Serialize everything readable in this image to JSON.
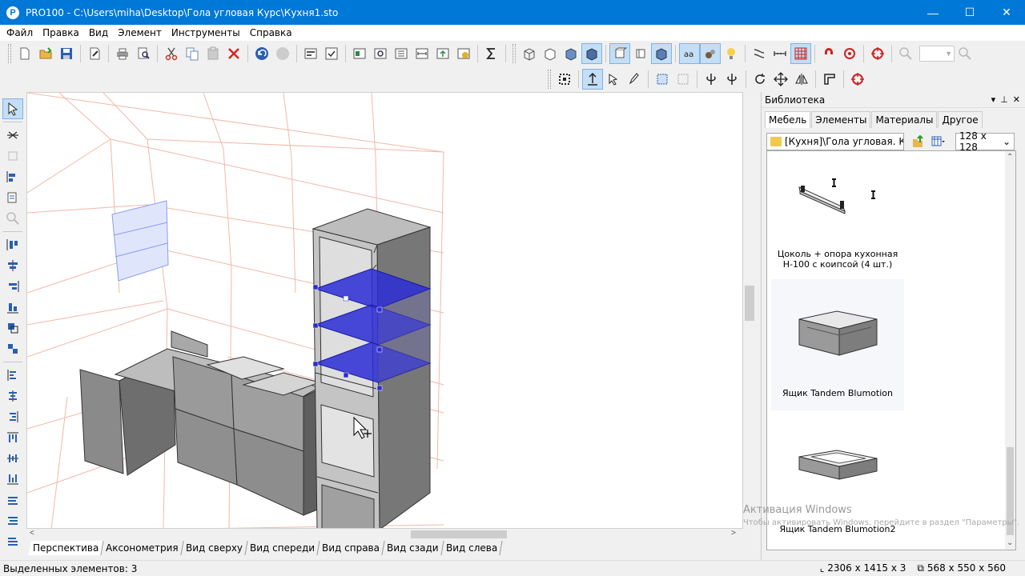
{
  "window": {
    "app_icon_letter": "P",
    "title": "PRO100 - C:\\Users\\miha\\Desktop\\Гола угловая Курс\\Кухня1.sto",
    "minimize": "—",
    "maximize": "☐",
    "close": "✕"
  },
  "menu": [
    "Файл",
    "Правка",
    "Вид",
    "Элемент",
    "Инструменты",
    "Справка"
  ],
  "view_tabs": [
    "Перспектива",
    "Аксонометрия",
    "Вид сверху",
    "Вид спереди",
    "Вид справа",
    "Вид сзади",
    "Вид слева"
  ],
  "library": {
    "title": "Библиотека",
    "title_ctrls": [
      "▾",
      "⊥",
      "✕"
    ],
    "tabs": [
      "Мебель",
      "Элементы",
      "Материалы",
      "Другое"
    ],
    "path": "[Кухня]\\Гола угловая. Ку",
    "thumb_size": "128 x 128",
    "items": [
      {
        "caption_line1": "Цоколь + опора кухонная",
        "caption_line2": "Н-100 с коипсой (4 шт.)"
      },
      {
        "caption_line1": "Ящик Tandem Blumotion",
        "caption_line2": ""
      },
      {
        "caption_line1": "Ящик Tandem Blumotion2",
        "caption_line2": ""
      }
    ]
  },
  "status": {
    "selected": "Выделенных элементов: 3",
    "dims1": "2306 x 1415 x 3",
    "dims2": "568 x 550 x 560"
  },
  "watermark": {
    "line1": "Активация Windows",
    "line2": "Чтобы активировать Windows, перейдите в раздел \"Параметры\"."
  },
  "colors": {
    "titlebar": "#0078d7",
    "selection": "#2b2bd6",
    "grid": "#f2b8a8"
  }
}
